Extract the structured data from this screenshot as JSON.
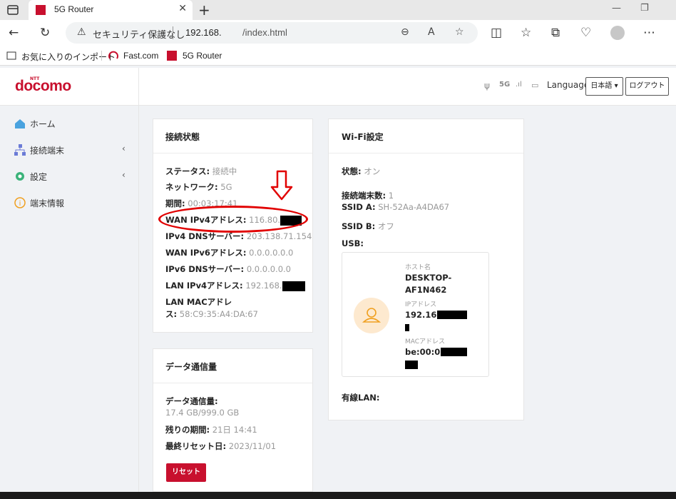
{
  "browser": {
    "tab_title": "5G Router",
    "tab_close": "✕",
    "new_tab": "+",
    "security_warning": "セキュリティ保護なし",
    "url_host": "192.168.",
    "url_path": "/index.html",
    "bookmarks": [
      {
        "label": "お気に入りのインポート"
      },
      {
        "label": "Fast.com"
      },
      {
        "label": "5G Router"
      }
    ],
    "colors": {
      "brand_red": "#c8102e"
    }
  },
  "header": {
    "logo_ntt": "NTT",
    "logo": "docomo",
    "net_type": "5G",
    "language_label": "Language",
    "language_select": "日本語",
    "logout": "ログアウト"
  },
  "sidebar": {
    "items": [
      {
        "label": "ホーム",
        "icon": "home-icon"
      },
      {
        "label": "接続端末",
        "icon": "network-icon"
      },
      {
        "label": "設定",
        "icon": "gear-icon"
      },
      {
        "label": "端末情報",
        "icon": "info-icon"
      }
    ]
  },
  "connection": {
    "title": "接続状態",
    "rows": [
      {
        "label": "ステータス:",
        "value": "接続中"
      },
      {
        "label": "ネットワーク:",
        "value": "5G"
      },
      {
        "label": "期間:",
        "value": "00:03:17:41"
      },
      {
        "label": "WAN IPv4アドレス:",
        "value": "116.80."
      },
      {
        "label": "IPv4 DNSサーバー:",
        "value": "203.138.71.154"
      },
      {
        "label": "WAN IPv6アドレス:",
        "value": "0.0.0.0.0.0"
      },
      {
        "label": "IPv6 DNSサーバー:",
        "value": "0.0.0.0.0.0"
      },
      {
        "label": "LAN IPv4アドレス:",
        "value": "192.168."
      },
      {
        "label": "LAN MACアドレ",
        "label2": "ス:",
        "value": "58:C9:35:A4:DA:67"
      }
    ]
  },
  "data_usage": {
    "title": "データ通信量",
    "usage_label": "データ通信量:",
    "usage_value": "17.4 GB/999.0 GB",
    "remaining_label": "残りの期間:",
    "remaining_value": "21日 14:41",
    "reset_date_label": "最終リセット日:",
    "reset_date_value": "2023/11/01",
    "reset_button": "リセット"
  },
  "wifi": {
    "title": "Wi-Fi設定",
    "status_label": "状態:",
    "status_value": "オン",
    "clients_label": "接続端末数:",
    "clients_value": "1",
    "ssid_a_label": "SSID A:",
    "ssid_a_value": "SH-52Aa-A4DA67",
    "ssid_b_label": "SSID B:",
    "ssid_b_value": "オフ",
    "usb_label": "USB:",
    "device": {
      "hostname_label": "ホスト名",
      "hostname_line1": "DESKTOP-",
      "hostname_line2": "AF1N462",
      "ip_label": "IPアドレス",
      "ip_value": "192.168.",
      "mac_label": "MACアドレス",
      "mac_value": "be:00:07:"
    },
    "wired_label": "有線LAN:"
  }
}
